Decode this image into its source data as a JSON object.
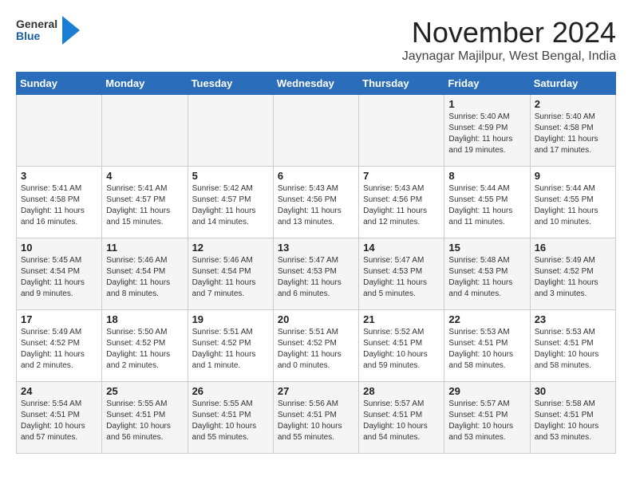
{
  "header": {
    "logo_general": "General",
    "logo_blue": "Blue",
    "month_title": "November 2024",
    "location": "Jaynagar Majilpur, West Bengal, India"
  },
  "weekdays": [
    "Sunday",
    "Monday",
    "Tuesday",
    "Wednesday",
    "Thursday",
    "Friday",
    "Saturday"
  ],
  "weeks": [
    [
      {
        "day": "",
        "info": ""
      },
      {
        "day": "",
        "info": ""
      },
      {
        "day": "",
        "info": ""
      },
      {
        "day": "",
        "info": ""
      },
      {
        "day": "",
        "info": ""
      },
      {
        "day": "1",
        "info": "Sunrise: 5:40 AM\nSunset: 4:59 PM\nDaylight: 11 hours\nand 19 minutes."
      },
      {
        "day": "2",
        "info": "Sunrise: 5:40 AM\nSunset: 4:58 PM\nDaylight: 11 hours\nand 17 minutes."
      }
    ],
    [
      {
        "day": "3",
        "info": "Sunrise: 5:41 AM\nSunset: 4:58 PM\nDaylight: 11 hours\nand 16 minutes."
      },
      {
        "day": "4",
        "info": "Sunrise: 5:41 AM\nSunset: 4:57 PM\nDaylight: 11 hours\nand 15 minutes."
      },
      {
        "day": "5",
        "info": "Sunrise: 5:42 AM\nSunset: 4:57 PM\nDaylight: 11 hours\nand 14 minutes."
      },
      {
        "day": "6",
        "info": "Sunrise: 5:43 AM\nSunset: 4:56 PM\nDaylight: 11 hours\nand 13 minutes."
      },
      {
        "day": "7",
        "info": "Sunrise: 5:43 AM\nSunset: 4:56 PM\nDaylight: 11 hours\nand 12 minutes."
      },
      {
        "day": "8",
        "info": "Sunrise: 5:44 AM\nSunset: 4:55 PM\nDaylight: 11 hours\nand 11 minutes."
      },
      {
        "day": "9",
        "info": "Sunrise: 5:44 AM\nSunset: 4:55 PM\nDaylight: 11 hours\nand 10 minutes."
      }
    ],
    [
      {
        "day": "10",
        "info": "Sunrise: 5:45 AM\nSunset: 4:54 PM\nDaylight: 11 hours\nand 9 minutes."
      },
      {
        "day": "11",
        "info": "Sunrise: 5:46 AM\nSunset: 4:54 PM\nDaylight: 11 hours\nand 8 minutes."
      },
      {
        "day": "12",
        "info": "Sunrise: 5:46 AM\nSunset: 4:54 PM\nDaylight: 11 hours\nand 7 minutes."
      },
      {
        "day": "13",
        "info": "Sunrise: 5:47 AM\nSunset: 4:53 PM\nDaylight: 11 hours\nand 6 minutes."
      },
      {
        "day": "14",
        "info": "Sunrise: 5:47 AM\nSunset: 4:53 PM\nDaylight: 11 hours\nand 5 minutes."
      },
      {
        "day": "15",
        "info": "Sunrise: 5:48 AM\nSunset: 4:53 PM\nDaylight: 11 hours\nand 4 minutes."
      },
      {
        "day": "16",
        "info": "Sunrise: 5:49 AM\nSunset: 4:52 PM\nDaylight: 11 hours\nand 3 minutes."
      }
    ],
    [
      {
        "day": "17",
        "info": "Sunrise: 5:49 AM\nSunset: 4:52 PM\nDaylight: 11 hours\nand 2 minutes."
      },
      {
        "day": "18",
        "info": "Sunrise: 5:50 AM\nSunset: 4:52 PM\nDaylight: 11 hours\nand 2 minutes."
      },
      {
        "day": "19",
        "info": "Sunrise: 5:51 AM\nSunset: 4:52 PM\nDaylight: 11 hours\nand 1 minute."
      },
      {
        "day": "20",
        "info": "Sunrise: 5:51 AM\nSunset: 4:52 PM\nDaylight: 11 hours\nand 0 minutes."
      },
      {
        "day": "21",
        "info": "Sunrise: 5:52 AM\nSunset: 4:51 PM\nDaylight: 10 hours\nand 59 minutes."
      },
      {
        "day": "22",
        "info": "Sunrise: 5:53 AM\nSunset: 4:51 PM\nDaylight: 10 hours\nand 58 minutes."
      },
      {
        "day": "23",
        "info": "Sunrise: 5:53 AM\nSunset: 4:51 PM\nDaylight: 10 hours\nand 58 minutes."
      }
    ],
    [
      {
        "day": "24",
        "info": "Sunrise: 5:54 AM\nSunset: 4:51 PM\nDaylight: 10 hours\nand 57 minutes."
      },
      {
        "day": "25",
        "info": "Sunrise: 5:55 AM\nSunset: 4:51 PM\nDaylight: 10 hours\nand 56 minutes."
      },
      {
        "day": "26",
        "info": "Sunrise: 5:55 AM\nSunset: 4:51 PM\nDaylight: 10 hours\nand 55 minutes."
      },
      {
        "day": "27",
        "info": "Sunrise: 5:56 AM\nSunset: 4:51 PM\nDaylight: 10 hours\nand 55 minutes."
      },
      {
        "day": "28",
        "info": "Sunrise: 5:57 AM\nSunset: 4:51 PM\nDaylight: 10 hours\nand 54 minutes."
      },
      {
        "day": "29",
        "info": "Sunrise: 5:57 AM\nSunset: 4:51 PM\nDaylight: 10 hours\nand 53 minutes."
      },
      {
        "day": "30",
        "info": "Sunrise: 5:58 AM\nSunset: 4:51 PM\nDaylight: 10 hours\nand 53 minutes."
      }
    ]
  ]
}
